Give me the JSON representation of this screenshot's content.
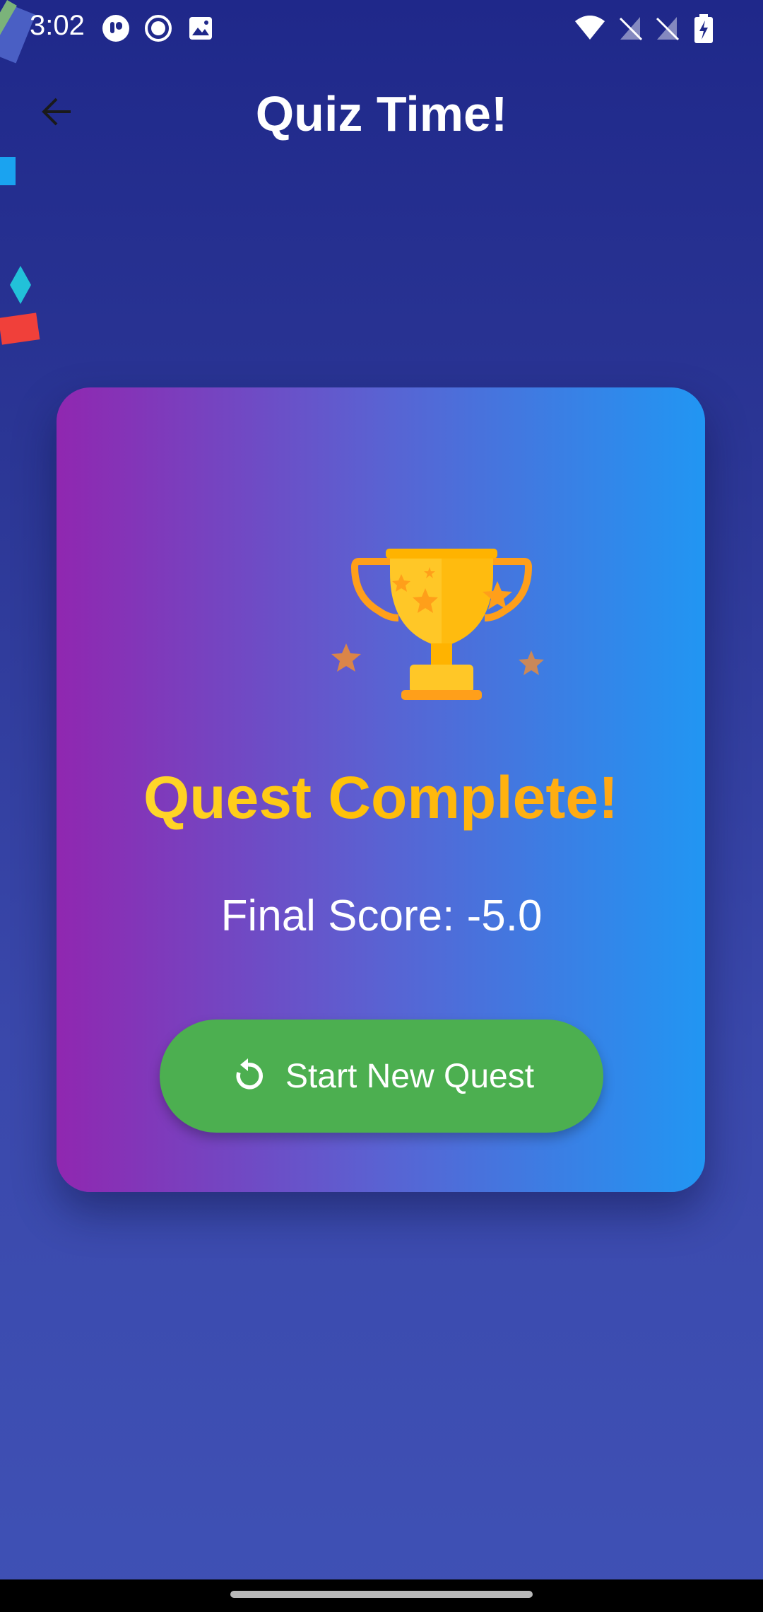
{
  "status_bar": {
    "time": "3:02",
    "icons": [
      "app-notification-icon",
      "record-icon",
      "image-icon",
      "wifi-icon",
      "no-sim-icon",
      "no-sim-icon",
      "battery-charging-icon"
    ]
  },
  "app_bar": {
    "title": "Quiz Time!",
    "back_icon": "arrow-back-icon"
  },
  "result_card": {
    "icon": "trophy-icon",
    "title": "Quest Complete!",
    "score_text": "Final Score: -5.0",
    "button": {
      "label": "Start New Quest",
      "icon": "refresh-icon"
    }
  },
  "colors": {
    "background_top": "#1f288a",
    "background_bottom": "#3f51b5",
    "card_gradient_start": "#9027b0",
    "card_gradient_end": "#2196f3",
    "title_gold": "#ffc107",
    "button_green": "#4caf50"
  }
}
